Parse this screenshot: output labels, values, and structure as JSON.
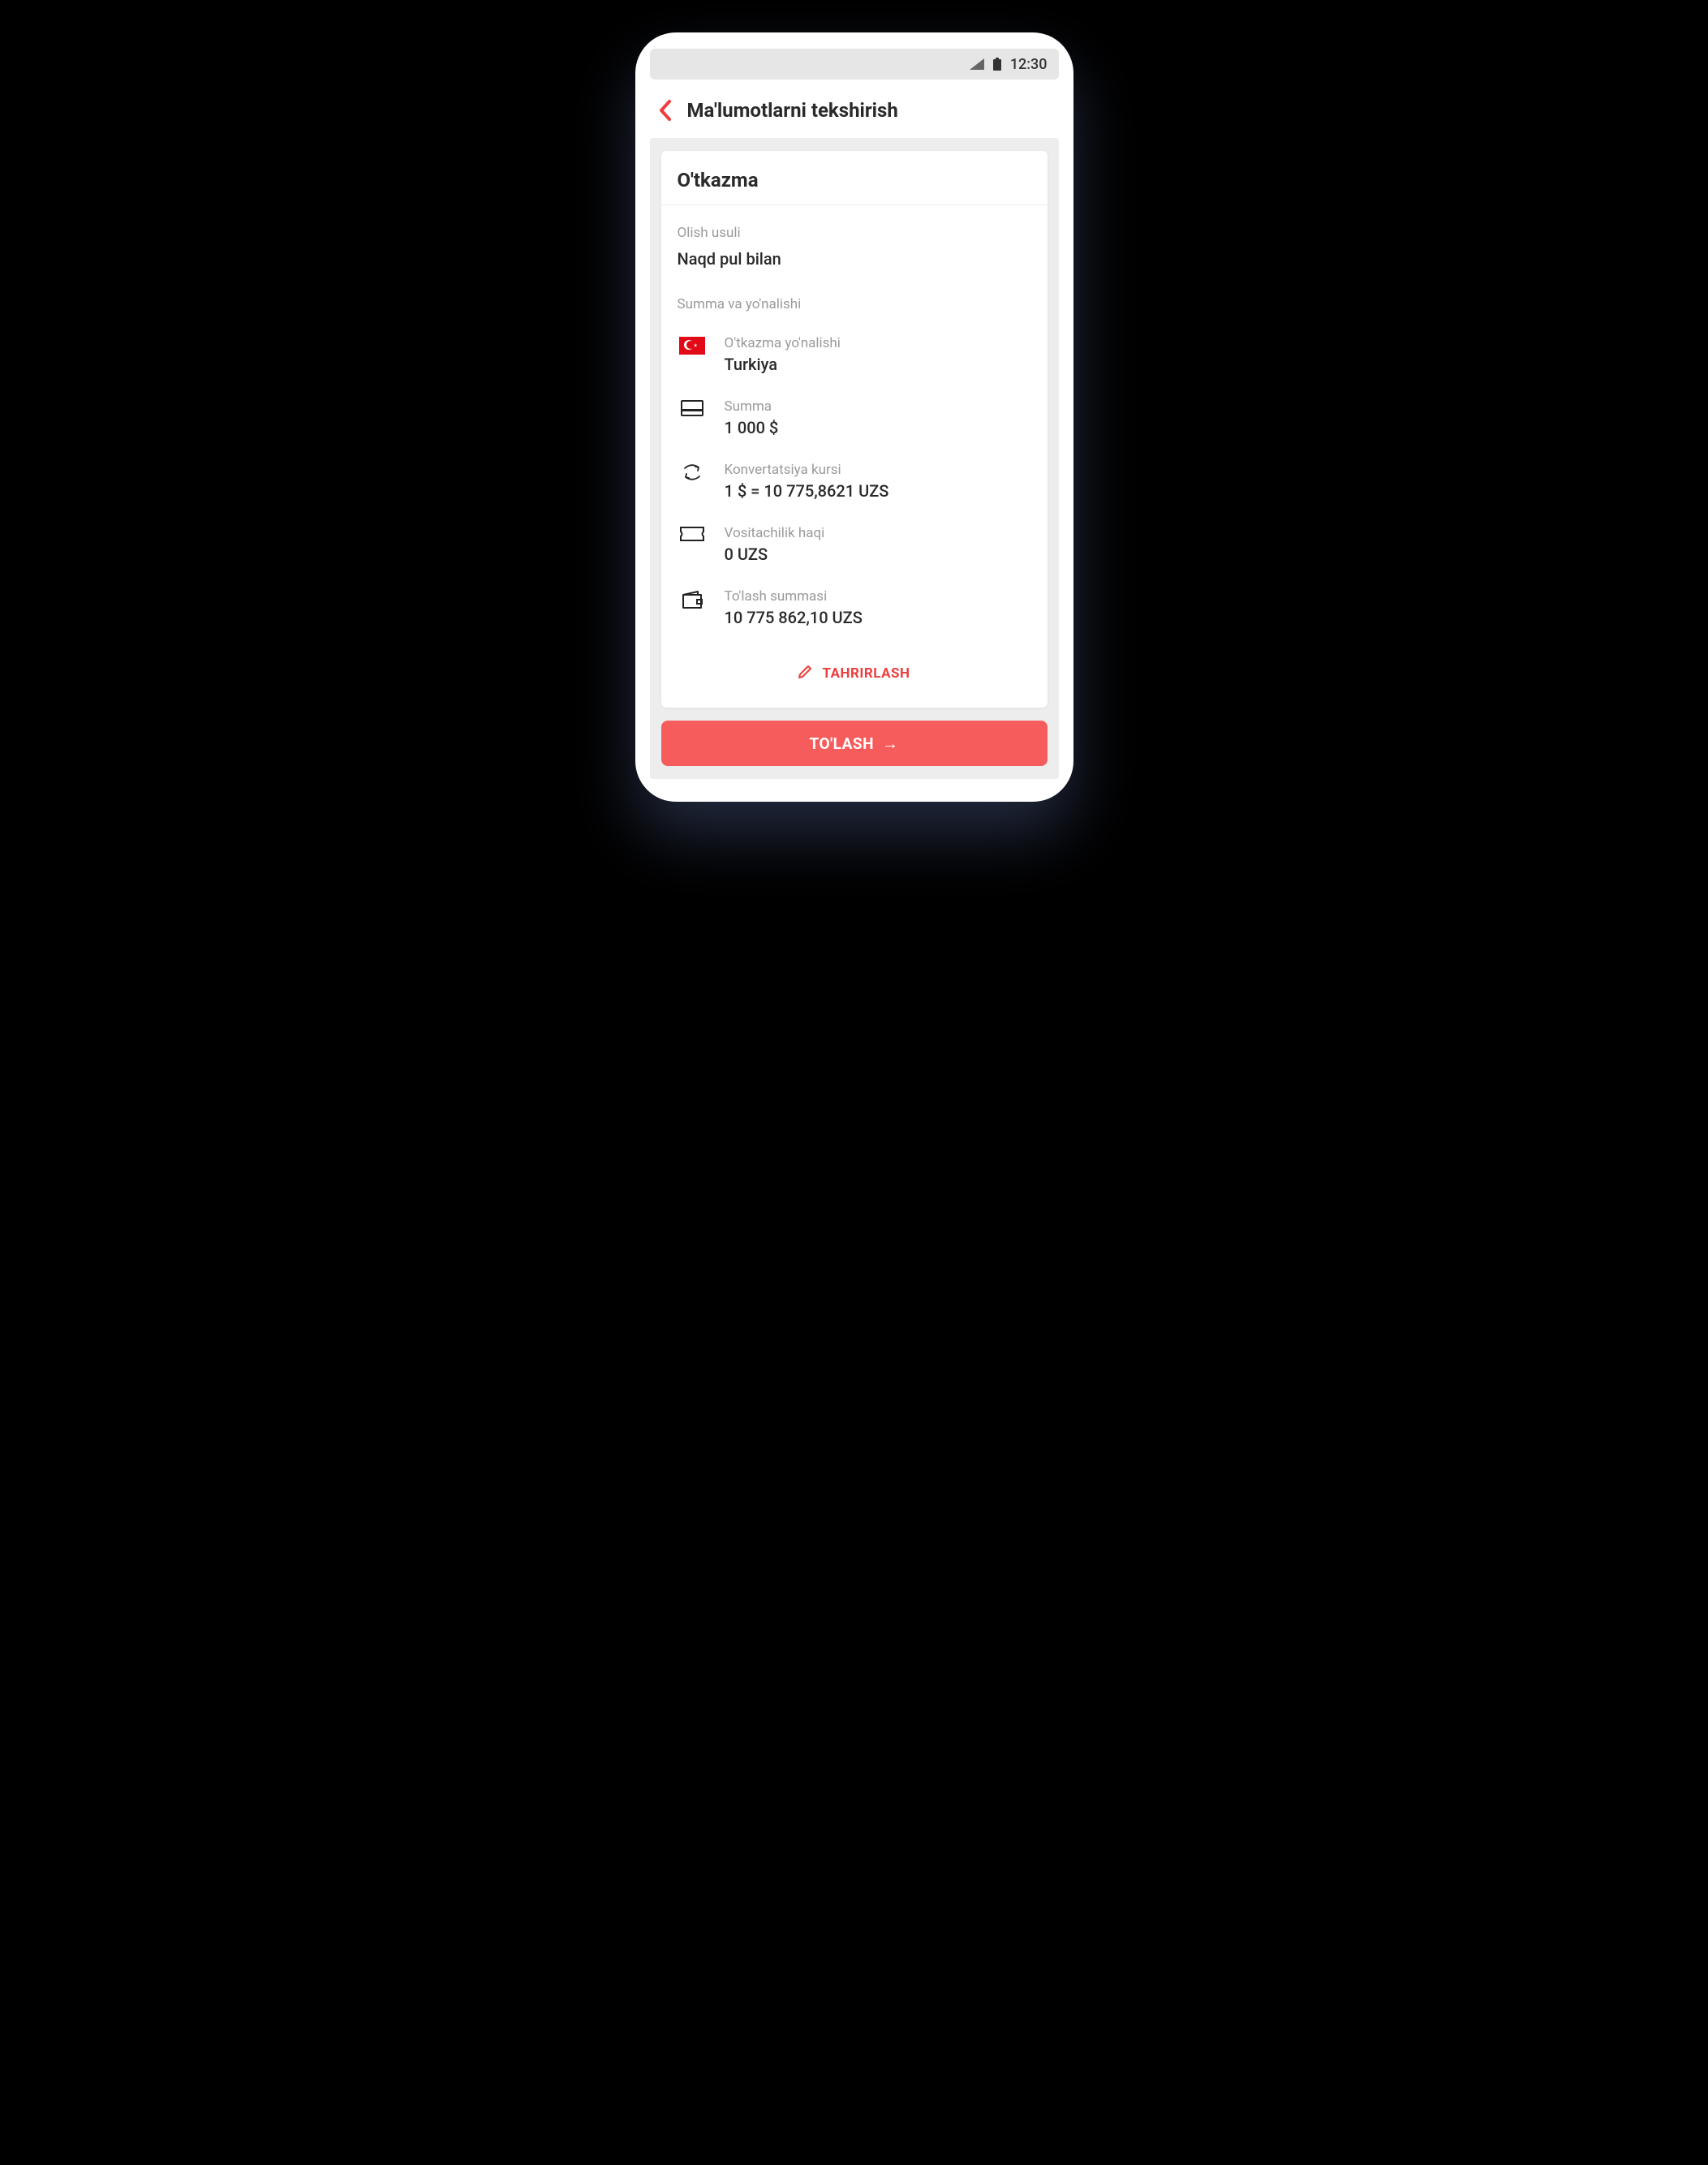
{
  "status_bar": {
    "time": "12:30"
  },
  "nav": {
    "title": "Ma'lumotlarni tekshirish"
  },
  "card": {
    "title": "O'tkazma",
    "method_label": "Olish usuli",
    "method_value": "Naqd pul bilan",
    "amount_dir_label": "Summa va yo'nalishi",
    "rows": {
      "direction": {
        "label": "O'tkazma yo'nalishi",
        "value": "Turkiya"
      },
      "amount": {
        "label": "Summa",
        "value": "1 000 $"
      },
      "rate": {
        "label": "Konvertatsiya kursi",
        "value": "1 $ = 10 775,8621 UZS"
      },
      "fee": {
        "label": "Vositachilik haqi",
        "value": "0 UZS"
      },
      "total": {
        "label": "To'lash summasi",
        "value": "10 775 862,10 UZS"
      }
    },
    "edit_label": "TAHRIRLASH"
  },
  "pay_button": {
    "label": "TO'LASH"
  }
}
